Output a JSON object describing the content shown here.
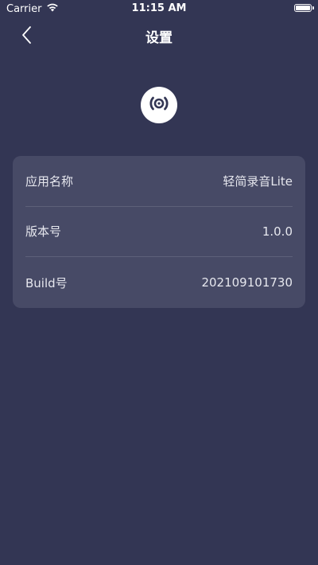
{
  "status_bar": {
    "carrier": "Carrier",
    "time": "11:15 AM",
    "battery_level": 1.0
  },
  "nav": {
    "title": "设置"
  },
  "app_info": {
    "rows": [
      {
        "label": "应用名称",
        "value": "轻简录音Lite"
      },
      {
        "label": "版本号",
        "value": "1.0.0"
      },
      {
        "label": "Build号",
        "value": "202109101730"
      }
    ]
  },
  "icons": {
    "back": "chevron-left-icon",
    "logo": "broadcast-icon",
    "wifi": "wifi-icon",
    "battery": "battery-icon"
  },
  "colors": {
    "background": "#333654",
    "card": "#474a66",
    "divider": "#5d6079",
    "text": "#ffffff"
  }
}
